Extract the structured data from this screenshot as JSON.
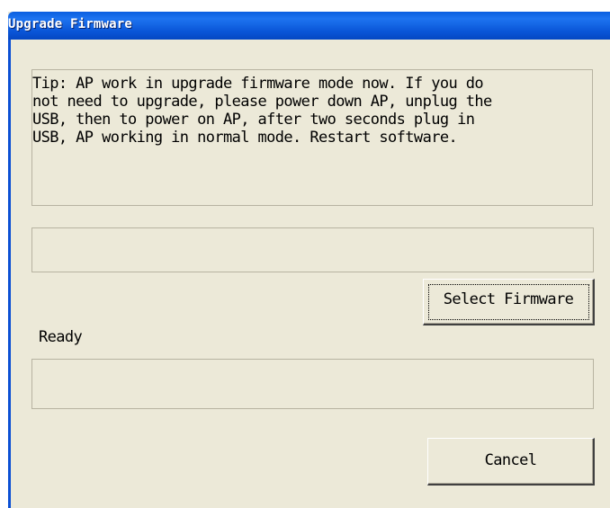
{
  "window": {
    "title": "Upgrade Firmware"
  },
  "tip": {
    "text": "Tip: AP work in upgrade firmware mode now. If you do\nnot need to upgrade, please power down AP, unplug the\nUSB, then to power on AP, after two seconds plug in\nUSB, AP working in normal mode. Restart software."
  },
  "firmware_path": {
    "value": ""
  },
  "buttons": {
    "select_firmware": "Select Firmware",
    "cancel": "Cancel"
  },
  "status": {
    "text": "Ready"
  },
  "progress": {
    "value": 0
  },
  "colors": {
    "titlebar": "#0a5ee0",
    "window_bg": "#ece9d8",
    "border": "#b7b3a1"
  }
}
